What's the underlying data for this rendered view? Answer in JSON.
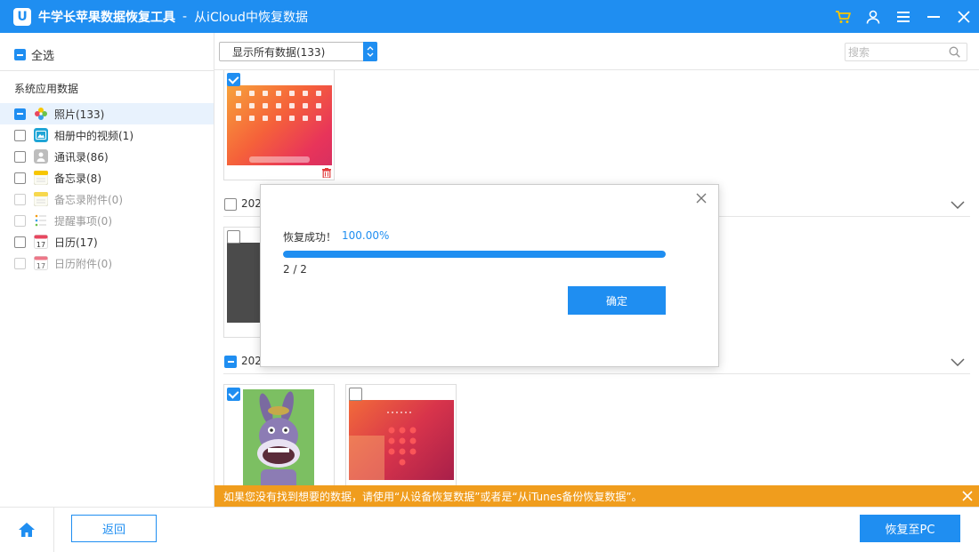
{
  "titlebar": {
    "app_name": "牛学长苹果数据恢复工具",
    "separator": "-",
    "subtitle": "从iCloud中恢复数据",
    "logo_letter": "U",
    "icons": [
      "cart-icon",
      "user-icon",
      "menu-icon",
      "minimize-icon",
      "close-icon"
    ],
    "accent_color": "#1f8ef1",
    "cart_color": "#f7c600"
  },
  "sidebar": {
    "select_all": "全选",
    "section_label": "系统应用数据",
    "items": [
      {
        "label": "照片(133)",
        "icon": "photos-icon",
        "state": "partial",
        "enabled": true
      },
      {
        "label": "相册中的视频(1)",
        "icon": "video-icon",
        "state": "unchecked",
        "enabled": true
      },
      {
        "label": "通讯录(86)",
        "icon": "contacts-icon",
        "state": "unchecked",
        "enabled": true
      },
      {
        "label": "备忘录(8)",
        "icon": "notes-icon",
        "state": "unchecked",
        "enabled": true
      },
      {
        "label": "备忘录附件(0)",
        "icon": "notes-attachment-icon",
        "state": "unchecked",
        "enabled": false
      },
      {
        "label": "提醒事项(0)",
        "icon": "reminders-icon",
        "state": "unchecked",
        "enabled": false
      },
      {
        "label": "日历(17)",
        "icon": "calendar-icon",
        "state": "unchecked",
        "enabled": true
      },
      {
        "label": "日历附件(0)",
        "icon": "calendar-attachment-icon",
        "state": "unchecked",
        "enabled": false
      }
    ]
  },
  "toolbar": {
    "filter_value": "显示所有数据(133)",
    "search_placeholder": "搜索"
  },
  "groups": [
    {
      "date": "202",
      "state": "unchecked"
    },
    {
      "date": "202",
      "state": "partial"
    }
  ],
  "banner": {
    "text": "如果您没有找到想要的数据，请使用“从设备恢复数据”或者是“从iTunes备份恢复数据”。",
    "color": "#f09d1d"
  },
  "footer": {
    "back_label": "返回",
    "recover_label": "恢复至PC"
  },
  "dialog": {
    "status": "恢复成功！",
    "percent": "100.00%",
    "progress": 1.0,
    "count": "2 / 2",
    "ok_label": "确定"
  }
}
